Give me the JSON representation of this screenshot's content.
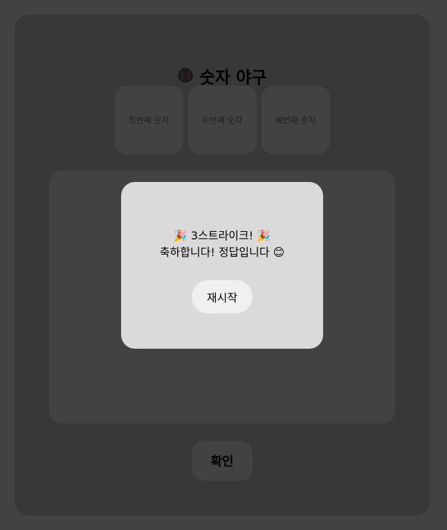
{
  "game": {
    "title": "숫자 야구",
    "title_icon": "baseball-icon"
  },
  "inputs": [
    {
      "placeholder": "첫번째 숫자",
      "value": ""
    },
    {
      "placeholder": "두번째 숫자",
      "value": ""
    },
    {
      "placeholder": "세번째 숫자",
      "value": ""
    }
  ],
  "confirm_label": "확인",
  "modal": {
    "line1": "🎉 3스트라이크! 🎉",
    "line2": "축하합니다! 정답입니다 😊",
    "restart_label": "재시작"
  },
  "colors": {
    "page_bg": "#424242",
    "card_bg": "#383838",
    "modal_bg": "#dadada",
    "button_bg": "#f0f0f0"
  }
}
